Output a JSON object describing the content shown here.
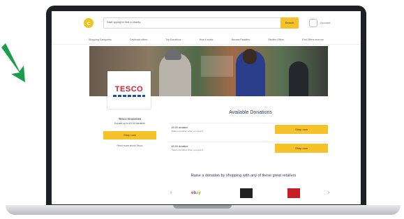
{
  "brand": {
    "accent": "#f6c22a",
    "arrow_color": "#1c9d4c",
    "title_color": "#2c3e66"
  },
  "header": {
    "search_placeholder": "Start typing to find a charity",
    "search_button": "Search",
    "account_label": "Account"
  },
  "nav": {
    "items": [
      "Shopping Categories",
      "Cashback offers",
      "Top Donations",
      "How it works",
      "Browse Retailers",
      "Student Offers",
      "Find Offers near me"
    ]
  },
  "charity": {
    "logo_text": "TESCO",
    "name": "Tesco Groceries",
    "subtitle": "Donate up to £0.00 donation",
    "button": "Shop now",
    "link": "Read more about Tesco"
  },
  "available": {
    "title": "Available Donations",
    "rows": [
      {
        "line1": "£0.00 donation",
        "line2": "Make a donation when you spend",
        "button": "Shop now"
      },
      {
        "line1": "£0.00 donation",
        "line2": "Make a donation when you spend",
        "button": "Shop now"
      }
    ]
  },
  "retailers": {
    "title": "Raise a donation by shopping with any of these great retailers",
    "prev": "‹",
    "next": "›",
    "items": [
      "ebay",
      "",
      ""
    ]
  }
}
